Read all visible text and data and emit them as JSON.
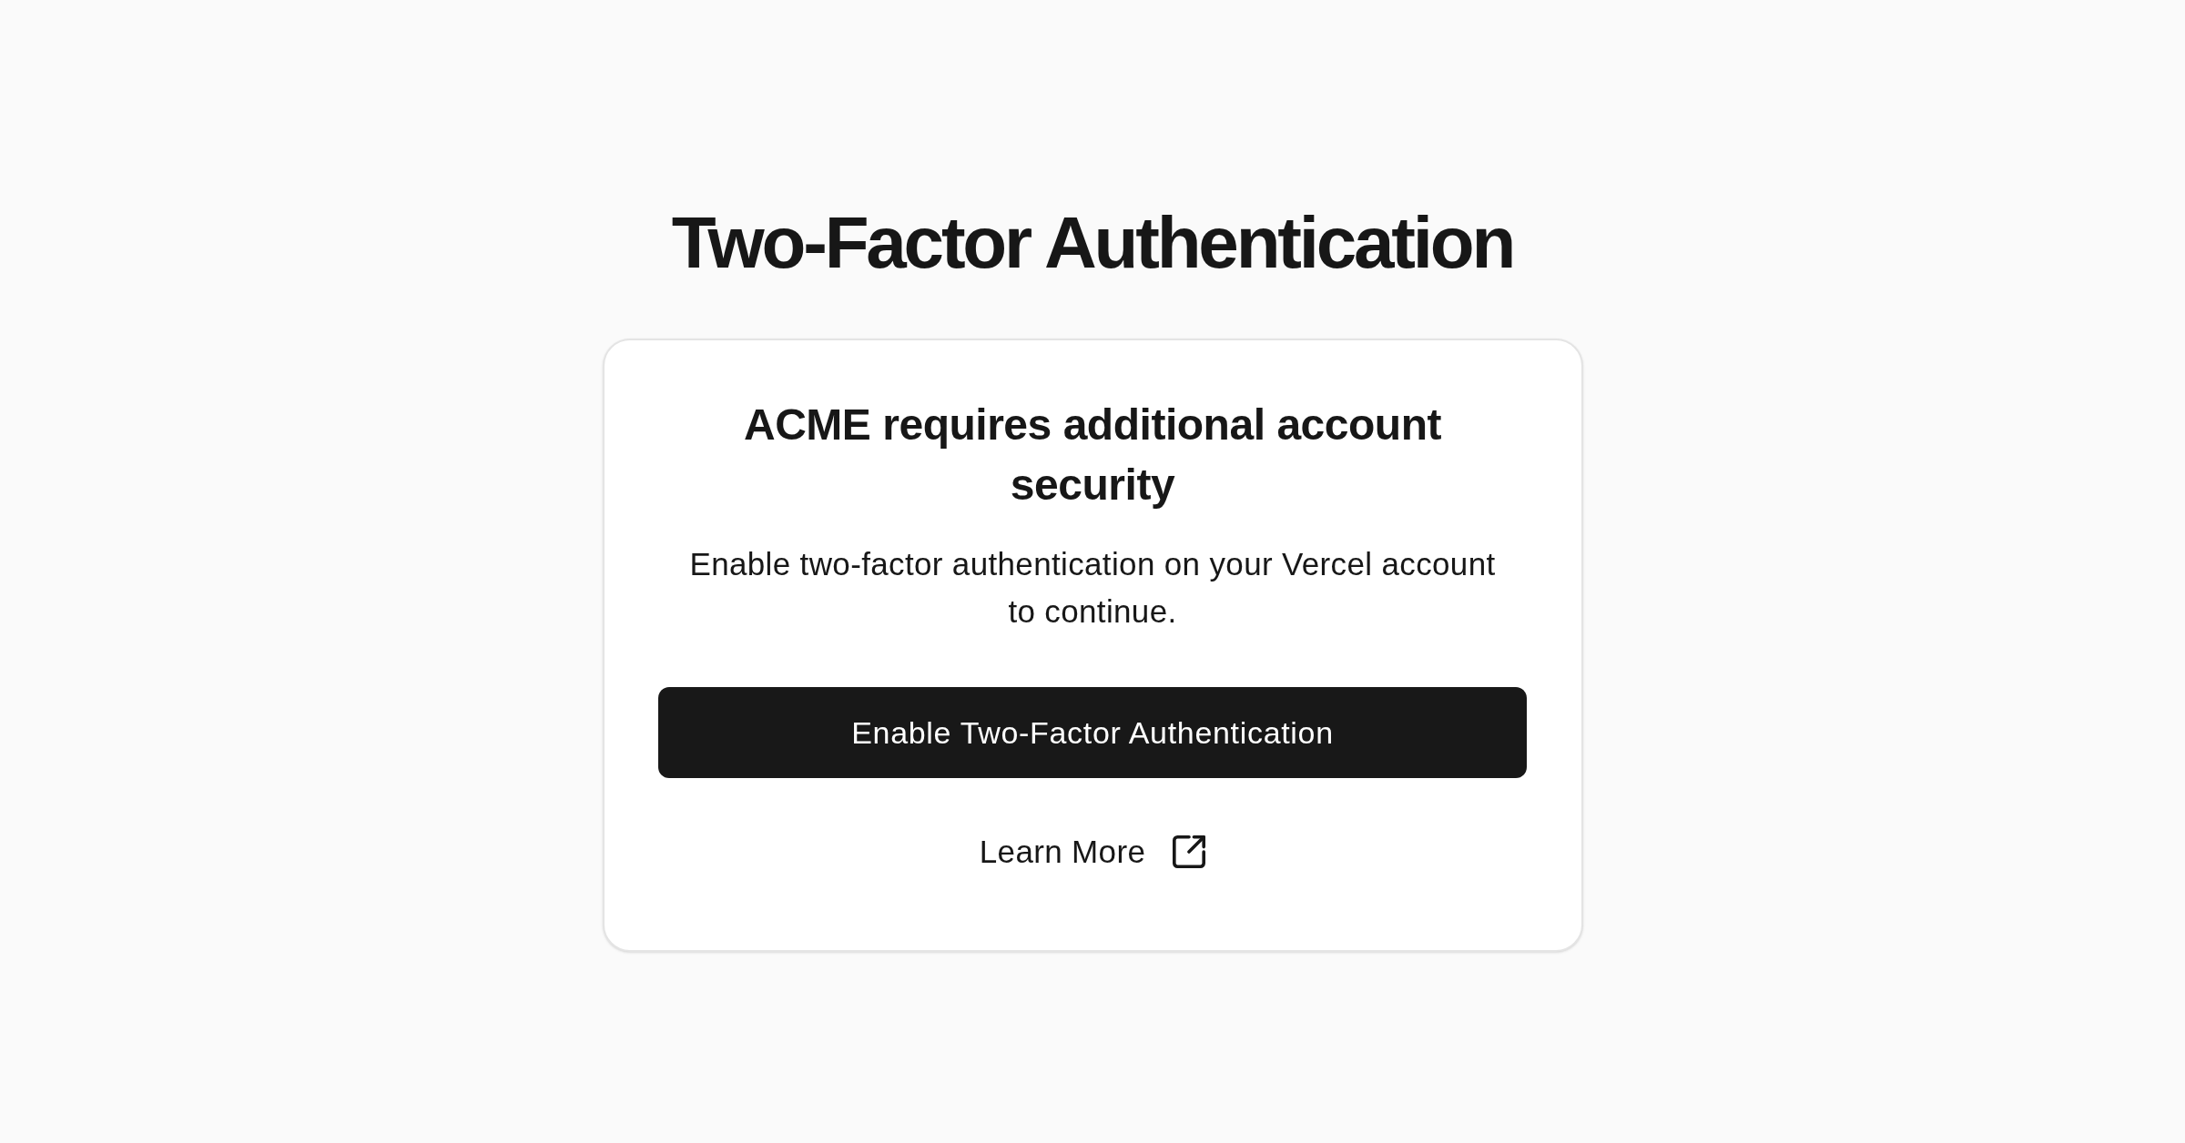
{
  "page_title": "Two-Factor Authentication",
  "card": {
    "heading": "ACME requires additional account security",
    "description": "Enable two-factor authentication on your Vercel account to continue.",
    "primary_button": "Enable Two-Factor Authentication",
    "learn_more_link": "Learn More"
  }
}
